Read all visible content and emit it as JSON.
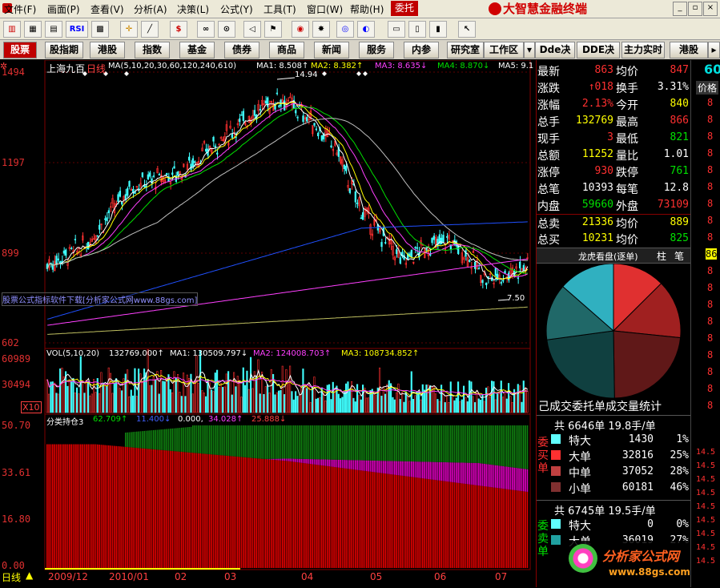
{
  "menu": [
    "文件(F)",
    "画面(P)",
    "查看(V)",
    "分析(A)",
    "决策(L)",
    "公式(Y)",
    "工具(T)",
    "窗口(W)",
    "帮助(H)"
  ],
  "weituo": "委托",
  "brand": "大智慧金融终端",
  "toolbar_icons": [
    "candle-icon",
    "calendar-icon",
    "chart-icon",
    "rsi-icon",
    "grid-icon",
    "cross-icon",
    "ruler-icon",
    "dollar-icon",
    "glasses-icon",
    "binoculars-icon",
    "megaphone-icon",
    "flag-icon",
    "globe-icon",
    "gear-icon",
    "target-icon",
    "book-icon",
    "notebook-icon",
    "library-icon",
    "arrow-icon"
  ],
  "rsi_label": "RSI",
  "nav": [
    "股票",
    "股指期",
    "港股",
    "指数",
    "基金",
    "债券",
    "商品",
    "新闻",
    "服务",
    "内参",
    "研究室",
    "工作区",
    "Dde决策",
    "DDE决策",
    "主力实时",
    "港股"
  ],
  "chart": {
    "stock_name": "上海九百",
    "period": "日线",
    "ma_header": "MA(5,10,20,30,60,120,240,610)",
    "ma1": "MA1: 8.508↑",
    "ma2": "MA2: 8.382↑",
    "ma3": "MA3: 8.635↓",
    "ma4": "MA4: 8.870↓",
    "ma5": "MA5: 9.1",
    "high_label": "14.94",
    "low_label": "7.50",
    "y_ticks": [
      "1494",
      "1197",
      "899",
      "602"
    ],
    "watermark": "股票公式指标软件下载[分析家公式网www.88gs.com]",
    "vol_header": "VOL(5,10,20)",
    "vol_value": "132769.000↑",
    "vol_ma1": "MA1: 130509.797↓",
    "vol_ma2": "MA2: 124008.703↑",
    "vol_ma3": "MA3: 108734.852↑",
    "vol_ticks": [
      "60989",
      "30494"
    ],
    "vol_unit": "X10",
    "pos_header": "分类持仓3",
    "pos_v1": "62.709↑",
    "pos_v2": "11.400↓",
    "pos_v3": "0.000,",
    "pos_v4": "34.028↑",
    "pos_v5": "25.888↓",
    "pos_ticks": [
      "50.70",
      "33.61",
      "16.80",
      "0.00"
    ],
    "bottom_period": "日线",
    "x_labels": [
      "2009/12",
      "2010/01",
      "02",
      "03",
      "04",
      "05",
      "06",
      "07"
    ]
  },
  "chart_data": [
    {
      "type": "line",
      "title": "上海九百 日线",
      "x": [
        "2009/12",
        "2010/01",
        "02",
        "03",
        "04",
        "05",
        "06",
        "07"
      ],
      "series": [
        {
          "name": "价格",
          "values": [
            9.0,
            11.5,
            12.4,
            13.8,
            14.3,
            9.6,
            8.7,
            8.2
          ]
        }
      ],
      "annotations": [
        "14.94",
        "7.50"
      ],
      "ylim": [
        6.02,
        14.94
      ]
    },
    {
      "type": "bar",
      "title": "VOL(5,10,20)",
      "categories": [
        "2009/12",
        "2010/01",
        "02",
        "03",
        "04",
        "05",
        "06",
        "07"
      ],
      "values": [
        18000,
        25000,
        28000,
        22000,
        21000,
        16000,
        15000,
        12000
      ],
      "ylim": [
        0,
        60989
      ]
    },
    {
      "type": "area",
      "title": "分类持仓3",
      "categories": [
        "2009/12",
        "2010/01",
        "02",
        "03",
        "04",
        "05",
        "06",
        "07"
      ],
      "series": [
        {
          "name": "红",
          "values": [
            44,
            43,
            41,
            38,
            35,
            31,
            29,
            28
          ]
        },
        {
          "name": "紫",
          "values": [
            0,
            0,
            0,
            3,
            5,
            6,
            7,
            8
          ]
        },
        {
          "name": "绿",
          "values": [
            0,
            0,
            6,
            9,
            13,
            15,
            16,
            16
          ]
        }
      ],
      "ylim": [
        0,
        50.7
      ]
    },
    {
      "type": "pie",
      "title": "龙虎看盘(逐单)",
      "categories": [
        "特大买",
        "大买",
        "中买",
        "小买",
        "特大卖",
        "大卖",
        "中卖",
        "小卖"
      ],
      "values": [
        1,
        25,
        28,
        46,
        0,
        27,
        27,
        46
      ],
      "caption": "己成交委托单成交量统计"
    }
  ],
  "quote": {
    "rows": [
      {
        "l1": "最新",
        "v1": "863",
        "c1": "red",
        "l2": "均价",
        "v2": "847",
        "c2": "red"
      },
      {
        "l1": "涨跌",
        "v1": "↑018",
        "c1": "red",
        "l2": "换手",
        "v2": "3.31%",
        "c2": "white"
      },
      {
        "l1": "涨幅",
        "v1": "2.13%",
        "c1": "red",
        "l2": "今开",
        "v2": "840",
        "c2": "yellow"
      },
      {
        "l1": "总手",
        "v1": "132769",
        "c1": "yellow",
        "l2": "最高",
        "v2": "866",
        "c2": "red"
      },
      {
        "l1": "现手",
        "v1": "3",
        "c1": "red",
        "l2": "最低",
        "v2": "821",
        "c2": "green"
      },
      {
        "l1": "总额",
        "v1": "11252",
        "c1": "yellow",
        "l2": "量比",
        "v2": "1.01",
        "c2": "white"
      },
      {
        "l1": "涨停",
        "v1": "930",
        "c1": "red",
        "l2": "跌停",
        "v2": "761",
        "c2": "green"
      },
      {
        "l1": "总笔",
        "v1": "10393",
        "c1": "white",
        "l2": "每笔",
        "v2": "12.8",
        "c2": "white"
      },
      {
        "l1": "内盘",
        "v1": "59660",
        "c1": "green",
        "l2": "外盘",
        "v2": "73109",
        "c2": "red"
      },
      {
        "l1": "总卖",
        "v1": "21336",
        "c1": "yellow",
        "l2": "均价",
        "v2": "889",
        "c2": "yellow"
      },
      {
        "l1": "总买",
        "v1": "10231",
        "c1": "yellow",
        "l2": "均价",
        "v2": "825",
        "c2": "green"
      }
    ],
    "lhkp_title": "龙虎看盘(逐单)",
    "tab_zhu": "柱",
    "tab_bi": "笔",
    "pie_caption": "己成交委托单成交量统计",
    "buy_summary": "共 6646单 19.8手/单",
    "sell_summary": "共 6745单 19.5手/单",
    "buy_side": "委买单",
    "sell_side": "委卖单",
    "buy_rows": [
      {
        "label": "特大",
        "count": "1430",
        "pct": "1%"
      },
      {
        "label": "大单",
        "count": "32816",
        "pct": "25%"
      },
      {
        "label": "中单",
        "count": "37052",
        "pct": "28%"
      },
      {
        "label": "小单",
        "count": "60181",
        "pct": "46%"
      }
    ],
    "sell_rows": [
      {
        "label": "特大",
        "count": "0",
        "pct": "0%"
      },
      {
        "label": "大单",
        "count": "36019",
        "pct": "27%"
      }
    ]
  },
  "far_right": {
    "top_value": "60",
    "top_label": "价格",
    "values": [
      "8",
      "8",
      "8",
      "8",
      "8",
      "8",
      "8",
      "8",
      "8",
      "86",
      "8",
      "8",
      "8",
      "8",
      "8",
      "8",
      "8",
      "8",
      "8"
    ],
    "tick_values": [
      "14.5",
      "14.5",
      "14.5",
      "14.5",
      "14.5",
      "14.5",
      "14.5",
      "14.5",
      "14.5"
    ]
  },
  "logo": {
    "text": "分析家公式网",
    "url_text": "www.88gs.com"
  },
  "colors": {
    "up": "#ff3030",
    "down": "#00e000",
    "accent": "#c00000",
    "ma_yellow": "#ffff00",
    "ma_pink": "#ff40ff",
    "ma_blue": "#2060ff",
    "ma_green": "#00c000",
    "bg": "#000000"
  }
}
